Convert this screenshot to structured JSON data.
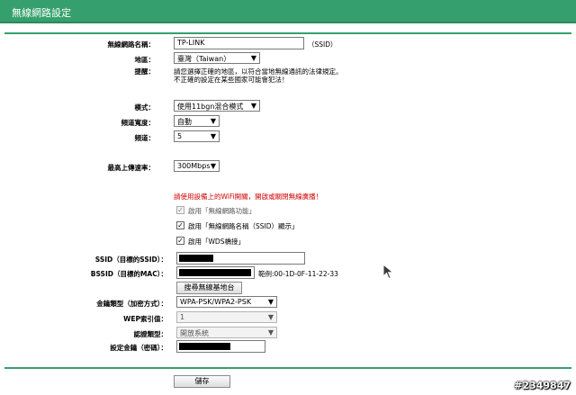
{
  "page": {
    "title": "無線網路設定"
  },
  "ssid": {
    "label": "無線網路名稱：",
    "value": "TP-LINK",
    "suffix": "（SSID）"
  },
  "region": {
    "label": "地區：",
    "value": "臺灣（Taiwan）"
  },
  "warning": {
    "label": "提醒：",
    "line1": "請您選擇正確的地區，以符合當地無線通訊的法律規定。",
    "line2": "不正確的設定在某些國家可能會犯法！"
  },
  "mode": {
    "label": "模式：",
    "value": "使用11bgn混合模式"
  },
  "channel_width": {
    "label": "頻道寬度：",
    "value": "自動"
  },
  "channel": {
    "label": "頻道：",
    "value": "5"
  },
  "max_tx_rate": {
    "label": "最高上傳速率：",
    "value": "300Mbps"
  },
  "wifi_notice": "請使用設備上的WiFi開關，開啟或關閉無線廣播！",
  "checkboxes": [
    {
      "label": "啟用「無線網路功能」",
      "checked": true,
      "disabled": true
    },
    {
      "label": "啟用「無線網路名稱（SSID）顯示」",
      "checked": true,
      "disabled": false
    },
    {
      "label": "啟用「WDS橋接」",
      "checked": true,
      "disabled": false
    }
  ],
  "wds": {
    "ssid_label": "SSID（目標的SSID）：",
    "bssid_label": "BSSID（目標的MAC）：",
    "bssid_example": "範例:00-1D-0F-11-22-33",
    "survey_button": "搜尋無線基地台",
    "key_type_label": "金鑰類型（加密方式）：",
    "key_type_value": "WPA-PSK/WPA2-PSK",
    "wep_index_label": "WEP索引值：",
    "wep_index_value": "1",
    "auth_type_label": "認證類型：",
    "auth_type_value": "開放系統",
    "password_label": "設定金鑰（密碼）："
  },
  "save_button": "儲存",
  "watermark": "#2349847",
  "colors": {
    "title_bar": "#35a06d",
    "divider": "#35a06d",
    "warning": "#d00000"
  },
  "icons": {
    "cursor": "mouse-pointer-icon",
    "dropdown": "chevron-down-icon",
    "checkbox": "check-icon"
  }
}
